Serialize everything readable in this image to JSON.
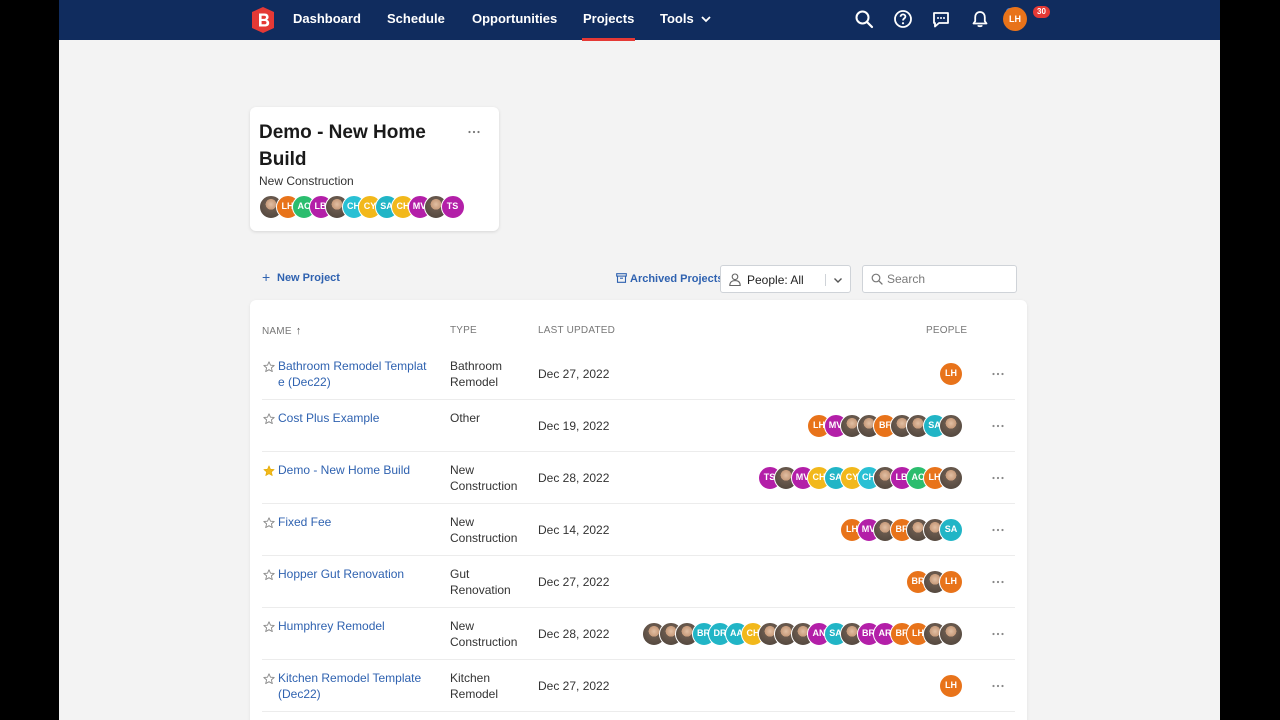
{
  "nav": {
    "links": [
      {
        "label": "Dashboard"
      },
      {
        "label": "Schedule"
      },
      {
        "label": "Opportunities"
      },
      {
        "label": "Projects"
      },
      {
        "label": "Tools"
      }
    ],
    "active": "Projects",
    "message_badge_color": "#2f80ed",
    "notification_count": "30",
    "user_initials": "LH",
    "brand_color": "#102c5e",
    "accent_color": "#e53935"
  },
  "featured": {
    "title": "Demo - New Home Build",
    "type": "New Construction",
    "people": [
      {
        "i": "",
        "c": "photo"
      },
      {
        "i": "LH",
        "c": "#e8731a"
      },
      {
        "i": "AC",
        "c": "#2bbd6e"
      },
      {
        "i": "LB",
        "c": "#b31fa8"
      },
      {
        "i": "",
        "c": "photo"
      },
      {
        "i": "CH",
        "c": "#29c0d4"
      },
      {
        "i": "CY",
        "c": "#f2b81b"
      },
      {
        "i": "SA",
        "c": "#21b5c6"
      },
      {
        "i": "CH",
        "c": "#f2b81b"
      },
      {
        "i": "MV",
        "c": "#b31fa8"
      },
      {
        "i": "",
        "c": "photo"
      },
      {
        "i": "TS",
        "c": "#b31fa8"
      }
    ]
  },
  "toolbar": {
    "new_project": "New Project",
    "archived": "Archived Projects",
    "people_filter": "People: All",
    "search_placeholder": "Search"
  },
  "table": {
    "headers": {
      "name": "NAME",
      "type": "TYPE",
      "updated": "LAST UPDATED",
      "people": "PEOPLE"
    },
    "rows": [
      {
        "name": "Bathroom Remodel Template (Dec22)",
        "type": "Bathroom Remodel",
        "updated": "Dec 27, 2022",
        "starred": false,
        "people": [
          {
            "i": "LH",
            "c": "#e8731a"
          }
        ]
      },
      {
        "name": "Cost Plus Example",
        "type": "Other",
        "updated": "Dec 19, 2022",
        "starred": false,
        "people": [
          {
            "i": "LH",
            "c": "#e8731a"
          },
          {
            "i": "MV",
            "c": "#b31fa8"
          },
          {
            "i": "",
            "c": "photo"
          },
          {
            "i": "",
            "c": "photo"
          },
          {
            "i": "BF",
            "c": "#e8731a"
          },
          {
            "i": "",
            "c": "photo"
          },
          {
            "i": "",
            "c": "photo"
          },
          {
            "i": "SA",
            "c": "#21b5c6"
          },
          {
            "i": "",
            "c": "photo"
          }
        ]
      },
      {
        "name": "Demo - New Home Build",
        "type": "New Construction",
        "updated": "Dec 28, 2022",
        "starred": true,
        "people": [
          {
            "i": "TS",
            "c": "#b31fa8"
          },
          {
            "i": "",
            "c": "photo"
          },
          {
            "i": "MV",
            "c": "#b31fa8"
          },
          {
            "i": "CH",
            "c": "#f2b81b"
          },
          {
            "i": "SA",
            "c": "#21b5c6"
          },
          {
            "i": "CY",
            "c": "#f2b81b"
          },
          {
            "i": "CH",
            "c": "#29c0d4"
          },
          {
            "i": "",
            "c": "photo"
          },
          {
            "i": "LB",
            "c": "#b31fa8"
          },
          {
            "i": "AC",
            "c": "#2bbd6e"
          },
          {
            "i": "LH",
            "c": "#e8731a"
          },
          {
            "i": "",
            "c": "photo"
          }
        ]
      },
      {
        "name": "Fixed Fee",
        "type": "New Construction",
        "updated": "Dec 14, 2022",
        "starred": false,
        "people": [
          {
            "i": "LH",
            "c": "#e8731a"
          },
          {
            "i": "MV",
            "c": "#b31fa8"
          },
          {
            "i": "",
            "c": "photo"
          },
          {
            "i": "BF",
            "c": "#e8731a"
          },
          {
            "i": "",
            "c": "photo"
          },
          {
            "i": "",
            "c": "photo"
          },
          {
            "i": "SA",
            "c": "#21b5c6"
          }
        ]
      },
      {
        "name": "Hopper Gut Renovation",
        "type": "Gut Renovation",
        "updated": "Dec 27, 2022",
        "starred": false,
        "people": [
          {
            "i": "BR",
            "c": "#e8731a"
          },
          {
            "i": "",
            "c": "photo"
          },
          {
            "i": "LH",
            "c": "#e8731a"
          }
        ]
      },
      {
        "name": "Humphrey Remodel",
        "type": "New Construction",
        "updated": "Dec 28, 2022",
        "starred": false,
        "people": [
          {
            "i": "",
            "c": "photo"
          },
          {
            "i": "",
            "c": "photo"
          },
          {
            "i": "",
            "c": "photo"
          },
          {
            "i": "BR",
            "c": "#21b5c6"
          },
          {
            "i": "DR",
            "c": "#21b5c6"
          },
          {
            "i": "AA",
            "c": "#21b5c6"
          },
          {
            "i": "CH",
            "c": "#f2b81b"
          },
          {
            "i": "",
            "c": "photo"
          },
          {
            "i": "",
            "c": "photo"
          },
          {
            "i": "",
            "c": "photo"
          },
          {
            "i": "AN",
            "c": "#b31fa8"
          },
          {
            "i": "SA",
            "c": "#21b5c6"
          },
          {
            "i": "",
            "c": "photo"
          },
          {
            "i": "BR",
            "c": "#b31fa8"
          },
          {
            "i": "AR",
            "c": "#b31fa8"
          },
          {
            "i": "BF",
            "c": "#e8731a"
          },
          {
            "i": "LH",
            "c": "#e8731a"
          },
          {
            "i": "",
            "c": "photo"
          },
          {
            "i": "",
            "c": "photo"
          }
        ]
      },
      {
        "name": "Kitchen Remodel Template (Dec22)",
        "type": "Kitchen Remodel",
        "updated": "Dec 27, 2022",
        "starred": false,
        "people": [
          {
            "i": "LH",
            "c": "#e8731a"
          }
        ]
      }
    ]
  }
}
